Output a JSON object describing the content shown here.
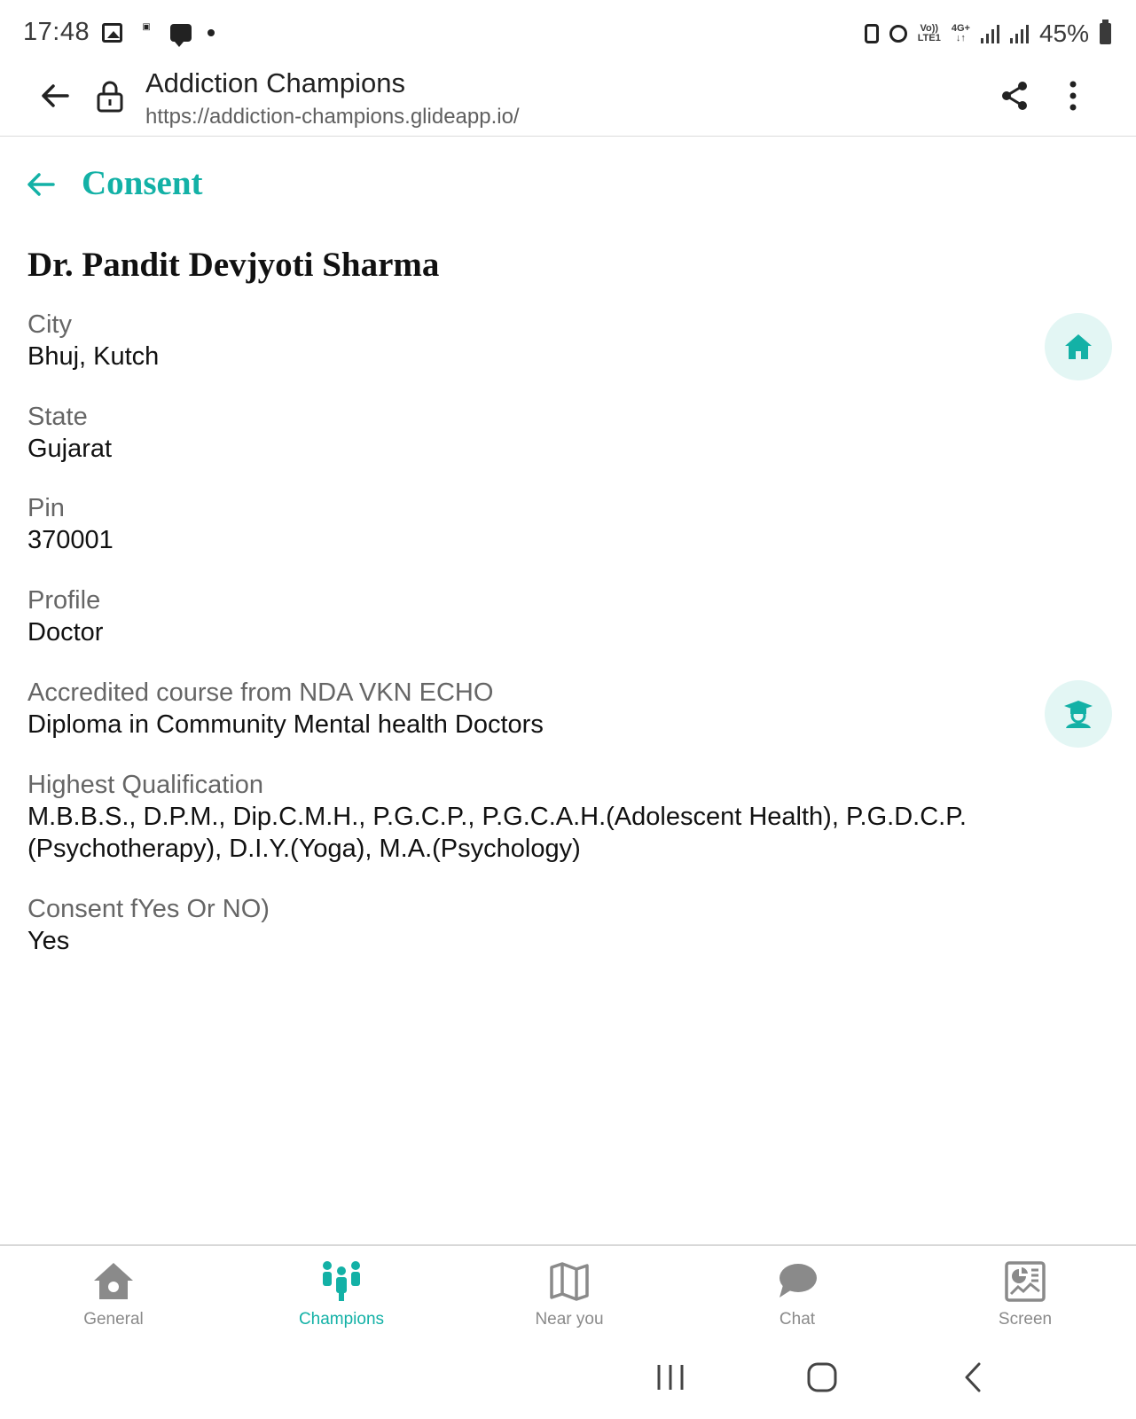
{
  "status_bar": {
    "time": "17:48",
    "battery": "45%",
    "network_label_top": "Vo))",
    "network_label_bottom": "LTE1",
    "network_type": "4G+"
  },
  "browser": {
    "title": "Addiction Champions",
    "url": "https://addiction-champions.glideapp.io/"
  },
  "page": {
    "title": "Consent",
    "name": "Dr. Pandit Devjyoti Sharma",
    "fields": [
      {
        "label": "City",
        "value": "Bhuj, Kutch"
      },
      {
        "label": "State",
        "value": "Gujarat"
      },
      {
        "label": "Pin",
        "value": "370001"
      },
      {
        "label": "Profile",
        "value": "Doctor"
      },
      {
        "label": "Accredited course from NDA VKN ECHO",
        "value": "Diploma in Community Mental health Doctors"
      },
      {
        "label": "Highest Qualification",
        "value": "M.B.B.S., D.P.M., Dip.C.M.H., P.G.C.P., P.G.C.A.H.(Adolescent Health), P.G.D.C.P.(Psychotherapy), D.I.Y.(Yoga), M.A.(Psychology)"
      },
      {
        "label": "Consent fYes Or NO)",
        "value": "Yes"
      }
    ]
  },
  "bottom_nav": {
    "items": [
      {
        "label": "General",
        "icon": "home-icon"
      },
      {
        "label": "Champions",
        "icon": "people-icon",
        "active": true
      },
      {
        "label": "Near you",
        "icon": "map-icon"
      },
      {
        "label": "Chat",
        "icon": "chat-icon"
      },
      {
        "label": "Screen",
        "icon": "screen-report-icon"
      }
    ]
  },
  "colors": {
    "accent": "#13b1a6",
    "fab_background": "#e3f6f4",
    "inactive_nav": "#8a8a8a"
  }
}
